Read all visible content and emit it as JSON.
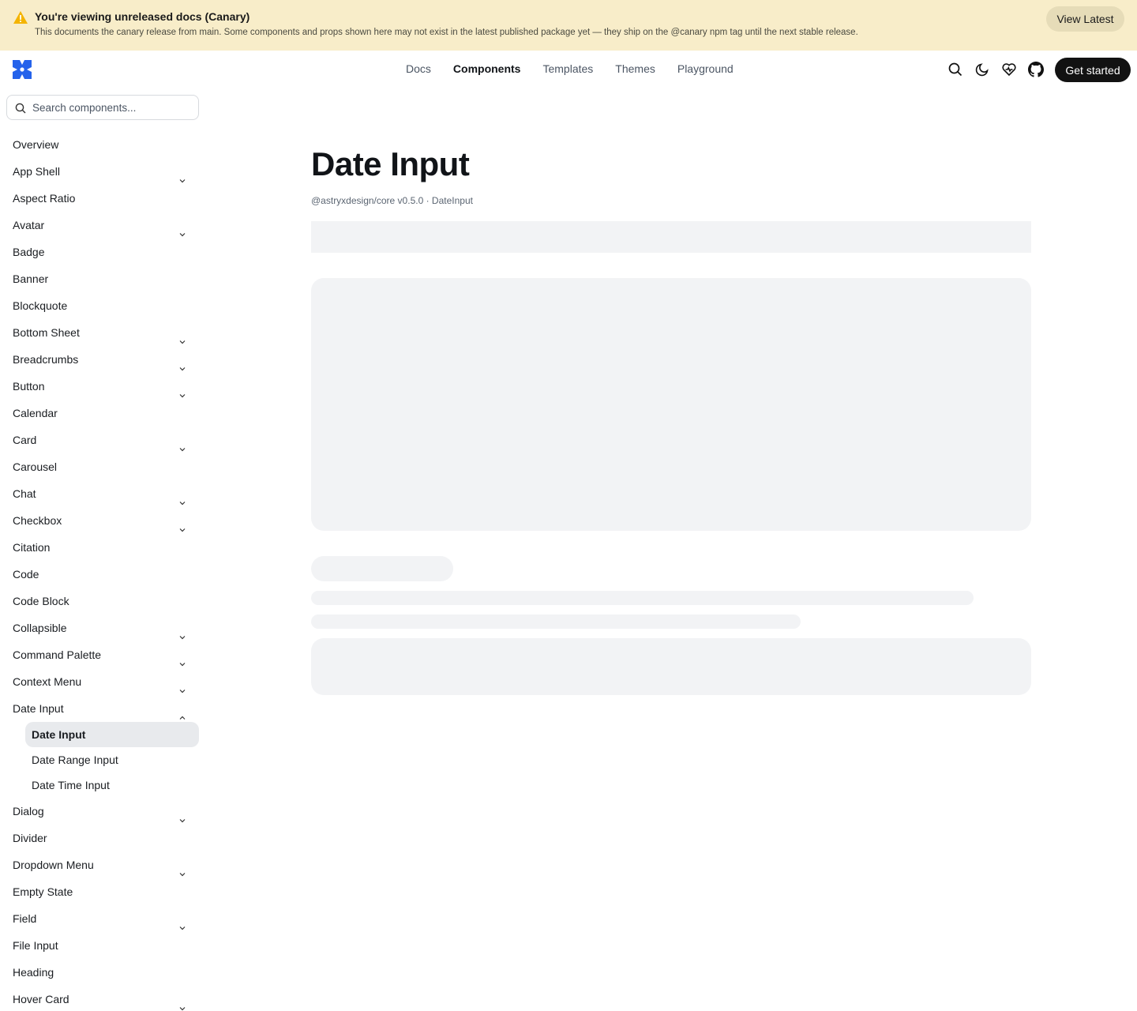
{
  "banner": {
    "title": "You're viewing unreleased docs (Canary)",
    "description": "This documents the canary release from main. Some components and props shown here may not exist in the latest published package yet — they ship on the @canary npm tag until the next stable release.",
    "button_label": "View Latest",
    "accent_color": "#f4b400"
  },
  "header": {
    "nav": [
      "Docs",
      "Components",
      "Templates",
      "Themes",
      "Playground"
    ],
    "active_nav": "Components",
    "cta_label": "Get started",
    "icons": [
      "search-icon",
      "moon-icon",
      "heart-icon",
      "github-icon"
    ],
    "brand_color": "#2563eb"
  },
  "sidebar": {
    "search_placeholder": "Search components...",
    "items": [
      {
        "label": "Overview",
        "expandable": false
      },
      {
        "label": "App Shell",
        "expandable": true
      },
      {
        "label": "Aspect Ratio",
        "expandable": false
      },
      {
        "label": "Avatar",
        "expandable": true
      },
      {
        "label": "Badge",
        "expandable": false
      },
      {
        "label": "Banner",
        "expandable": false
      },
      {
        "label": "Blockquote",
        "expandable": false
      },
      {
        "label": "Bottom Sheet",
        "expandable": true
      },
      {
        "label": "Breadcrumbs",
        "expandable": true
      },
      {
        "label": "Button",
        "expandable": true
      },
      {
        "label": "Calendar",
        "expandable": false
      },
      {
        "label": "Card",
        "expandable": true
      },
      {
        "label": "Carousel",
        "expandable": false
      },
      {
        "label": "Chat",
        "expandable": true
      },
      {
        "label": "Checkbox",
        "expandable": true
      },
      {
        "label": "Citation",
        "expandable": false
      },
      {
        "label": "Code",
        "expandable": false
      },
      {
        "label": "Code Block",
        "expandable": false
      },
      {
        "label": "Collapsible",
        "expandable": true
      },
      {
        "label": "Command Palette",
        "expandable": true
      },
      {
        "label": "Context Menu",
        "expandable": true
      },
      {
        "label": "Date Input",
        "expandable": true,
        "expanded": true,
        "children": [
          "Date Input",
          "Date Range Input",
          "Date Time Input"
        ],
        "active_child": "Date Input"
      },
      {
        "label": "Dialog",
        "expandable": true
      },
      {
        "label": "Divider",
        "expandable": false
      },
      {
        "label": "Dropdown Menu",
        "expandable": true
      },
      {
        "label": "Empty State",
        "expandable": false
      },
      {
        "label": "Field",
        "expandable": true
      },
      {
        "label": "File Input",
        "expandable": false
      },
      {
        "label": "Heading",
        "expandable": false
      },
      {
        "label": "Hover Card",
        "expandable": true
      }
    ]
  },
  "main": {
    "title": "Date Input",
    "meta": "@astryxdesign/core v0.5.0 · DateInput"
  }
}
